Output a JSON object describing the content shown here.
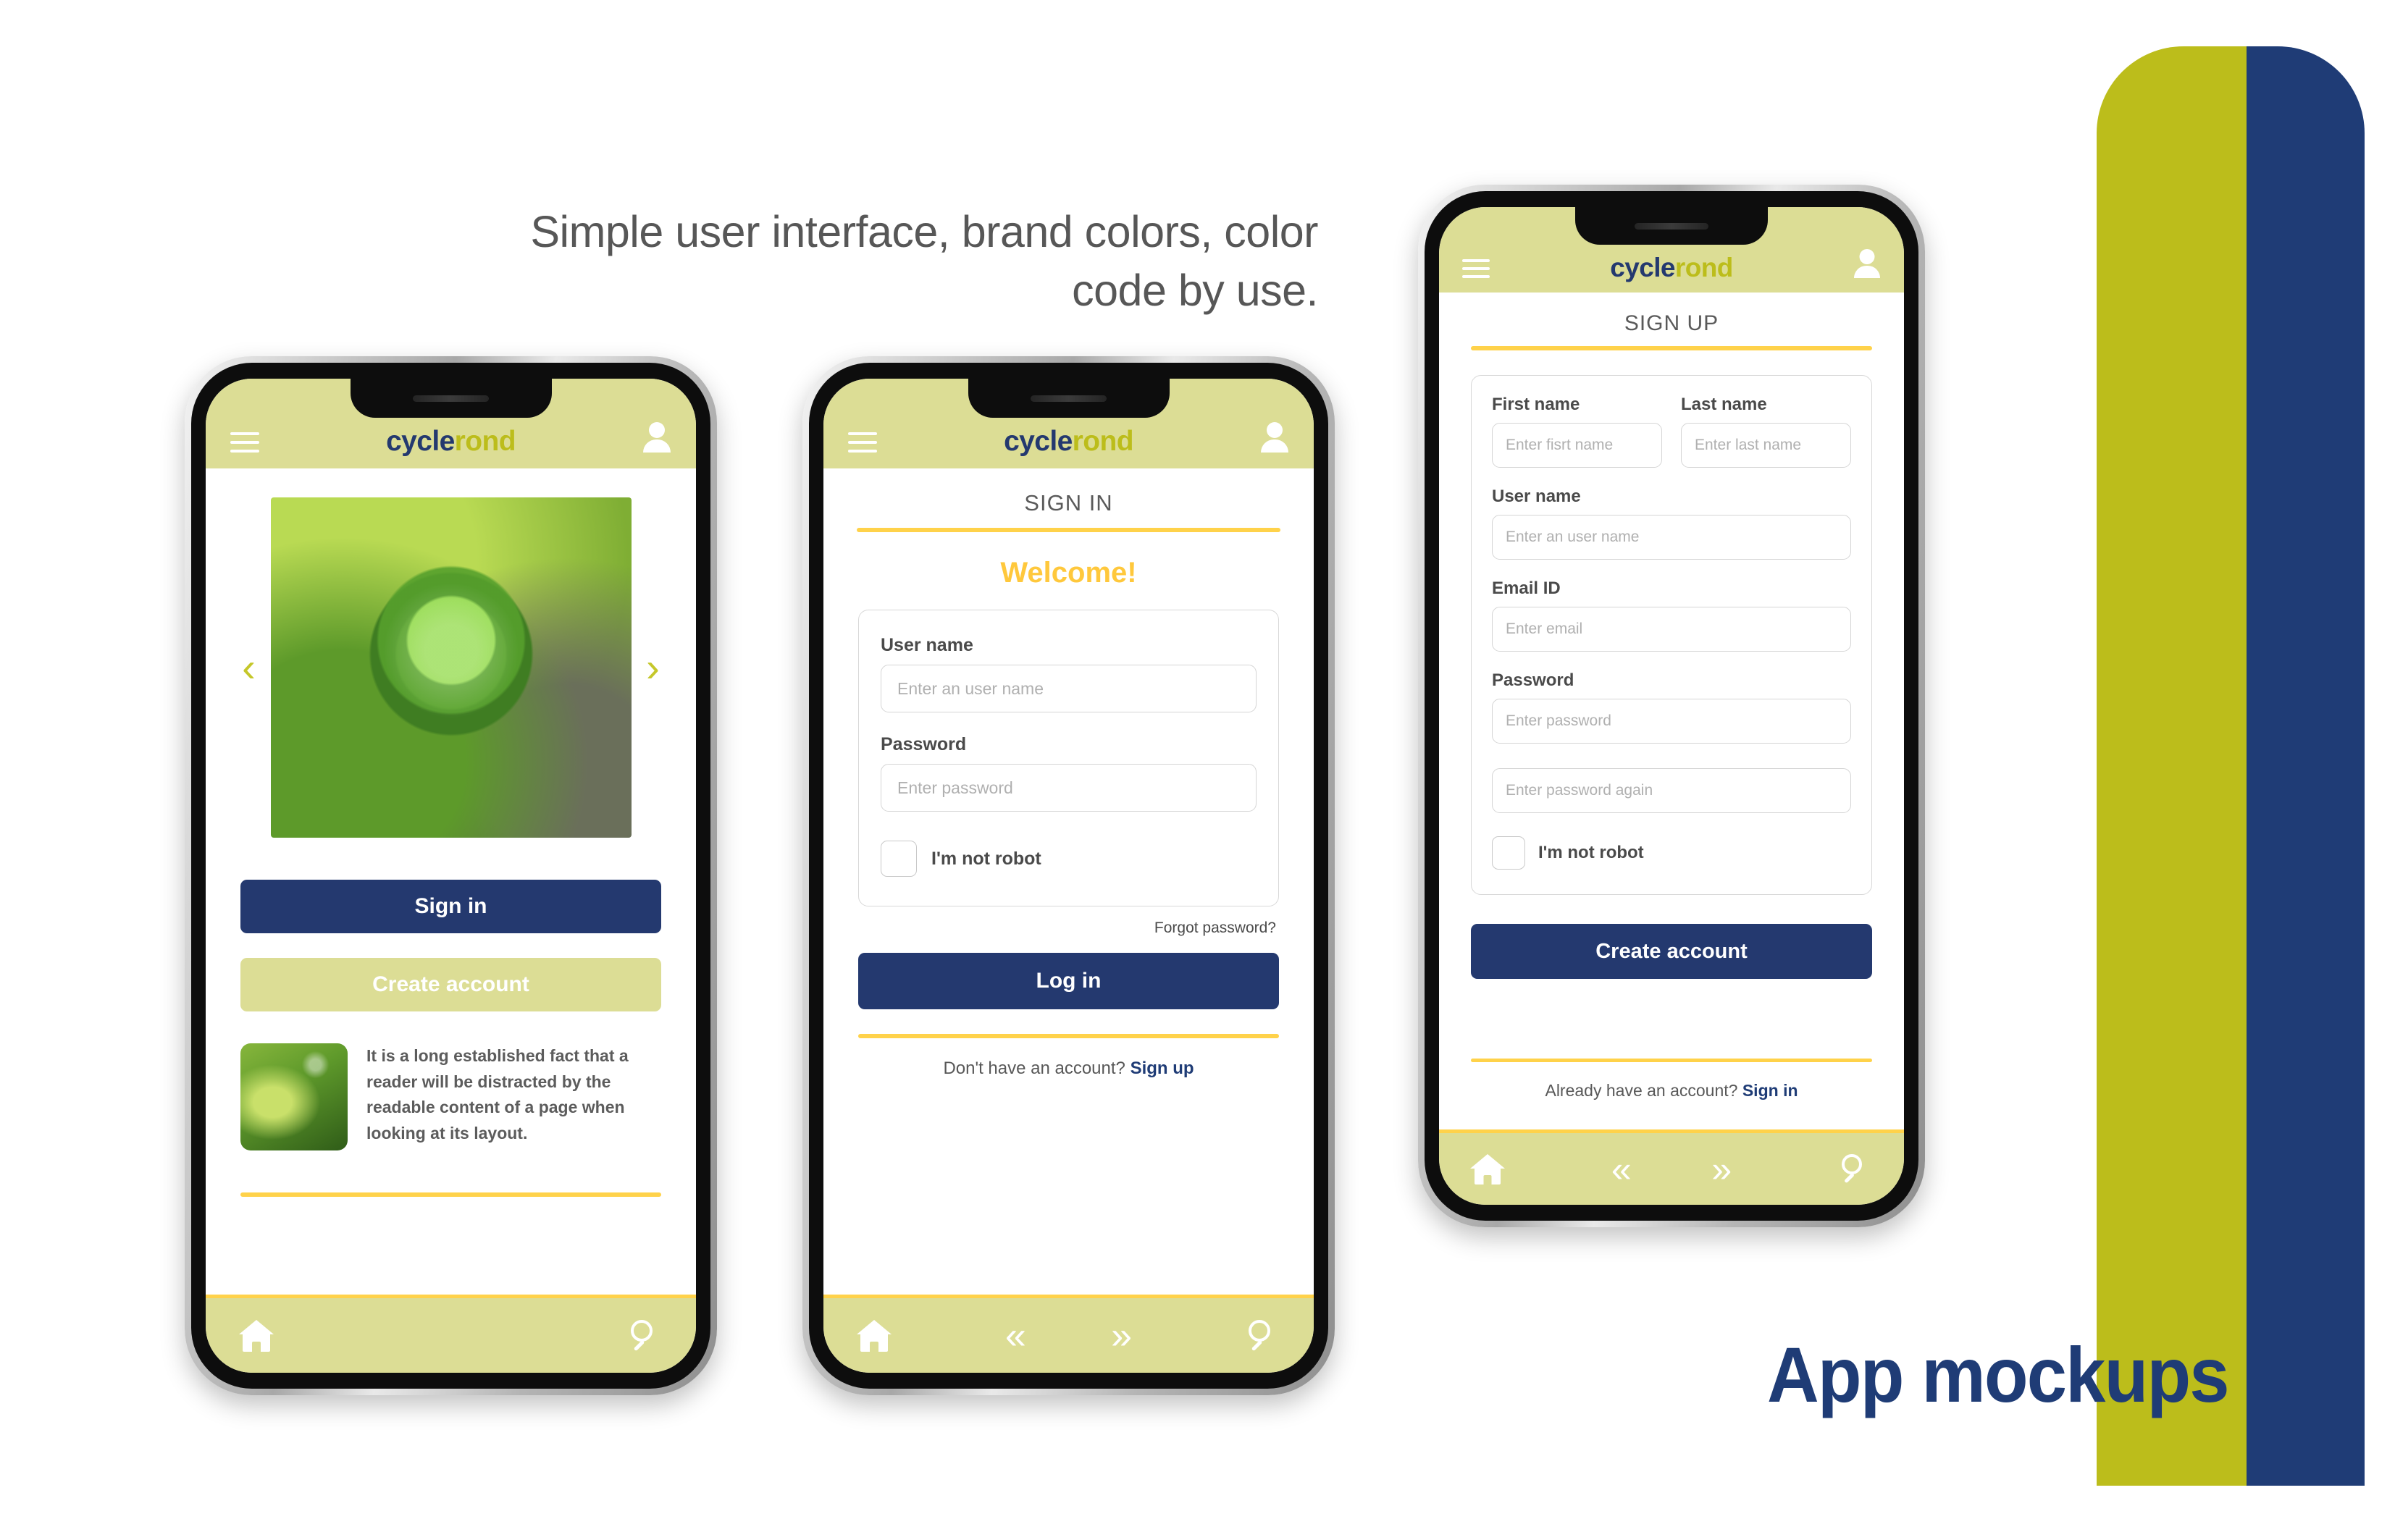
{
  "headline": "Simple user interface, brand colors, color code by use.",
  "caption": "App mockups",
  "brand": {
    "logo_first": "cycle",
    "logo_second": "rond",
    "navy": "#24396f",
    "olive_light": "#dcdd95",
    "olive_strong": "#bcbd1b",
    "gold": "#ffd24a",
    "navy_deep": "#1f3c76"
  },
  "icons": {
    "menu": "hamburger-menu-icon",
    "account": "user-account-icon",
    "home": "home-icon",
    "prev": "«",
    "next": "»",
    "search": "search-icon",
    "carousel_prev": "‹",
    "carousel_next": "›"
  },
  "phone_home": {
    "carousel": {
      "prev_label": "‹",
      "next_label": "›",
      "image_alt": "green-glass-globe-on-moss"
    },
    "sign_in_button": "Sign in",
    "create_account_button": "Create account",
    "article": {
      "text": "It is a long established fact that a reader will be distracted by the readable content of a page when looking at its layout.",
      "thumb_alt": "green-wheat-field-thumbnail"
    },
    "nav": {
      "home": "home",
      "search": "search"
    }
  },
  "phone_signin": {
    "title": "SIGN IN",
    "welcome": "Welcome!",
    "fields": [
      {
        "label": "User name",
        "placeholder": "Enter an user name"
      },
      {
        "label": "Password",
        "placeholder": "Enter password"
      }
    ],
    "robot_label": "I'm not robot",
    "forgot": "Forgot password?",
    "submit": "Log in",
    "footer_text": "Don't have an account?",
    "footer_link": "Sign up",
    "nav": {
      "home": "home",
      "prev": "«",
      "next": "»",
      "search": "search"
    }
  },
  "phone_signup": {
    "title": "SIGN UP",
    "name_fields": [
      {
        "label": "First name",
        "placeholder": "Enter fisrt name"
      },
      {
        "label": "Last name",
        "placeholder": "Enter last name"
      }
    ],
    "fields": [
      {
        "label": "User name",
        "placeholder": "Enter an user name"
      },
      {
        "label": "Email ID",
        "placeholder": "Enter email"
      },
      {
        "label": "Password",
        "placeholder": "Enter password"
      }
    ],
    "confirm_placeholder": "Enter password again",
    "robot_label": "I'm not robot",
    "submit": "Create account",
    "footer_text": "Already have an account?",
    "footer_link": "Sign in",
    "nav": {
      "home": "home",
      "prev": "«",
      "next": "»",
      "search": "search"
    }
  }
}
